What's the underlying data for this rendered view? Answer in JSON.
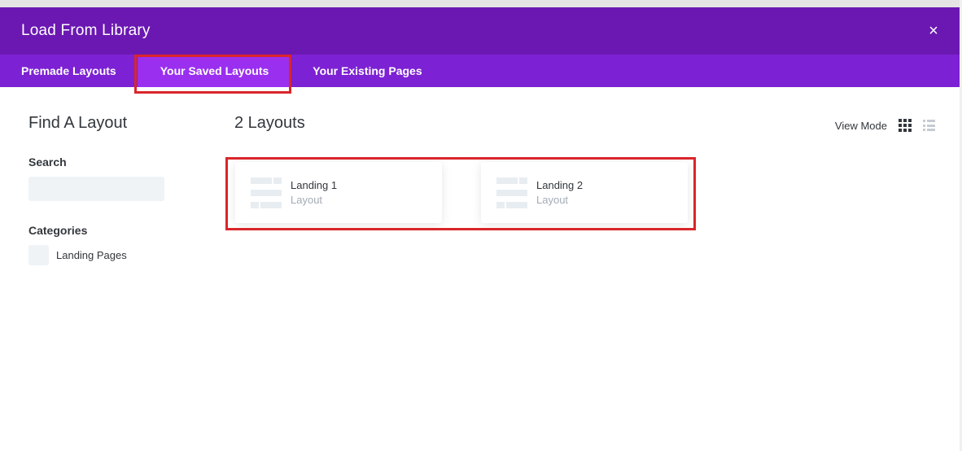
{
  "header": {
    "title": "Load From Library",
    "close_icon": "×"
  },
  "tabs": [
    {
      "label": "Premade Layouts",
      "active": false
    },
    {
      "label": "Your Saved Layouts",
      "active": true
    },
    {
      "label": "Your Existing Pages",
      "active": false
    }
  ],
  "sidebar": {
    "title": "Find A Layout",
    "search_label": "Search",
    "search_placeholder": "",
    "categories_label": "Categories",
    "categories": [
      {
        "label": "Landing Pages",
        "checked": false
      }
    ]
  },
  "main": {
    "count_title": "2 Layouts",
    "view_mode_label": "View Mode",
    "layouts": [
      {
        "name": "Landing 1",
        "type": "Layout"
      },
      {
        "name": "Landing 2",
        "type": "Layout"
      }
    ]
  },
  "colors": {
    "header": "#6b18b2",
    "tabs": "#7c21d3",
    "active_tab": "#9a2ff0",
    "highlight": "#d9262b"
  }
}
